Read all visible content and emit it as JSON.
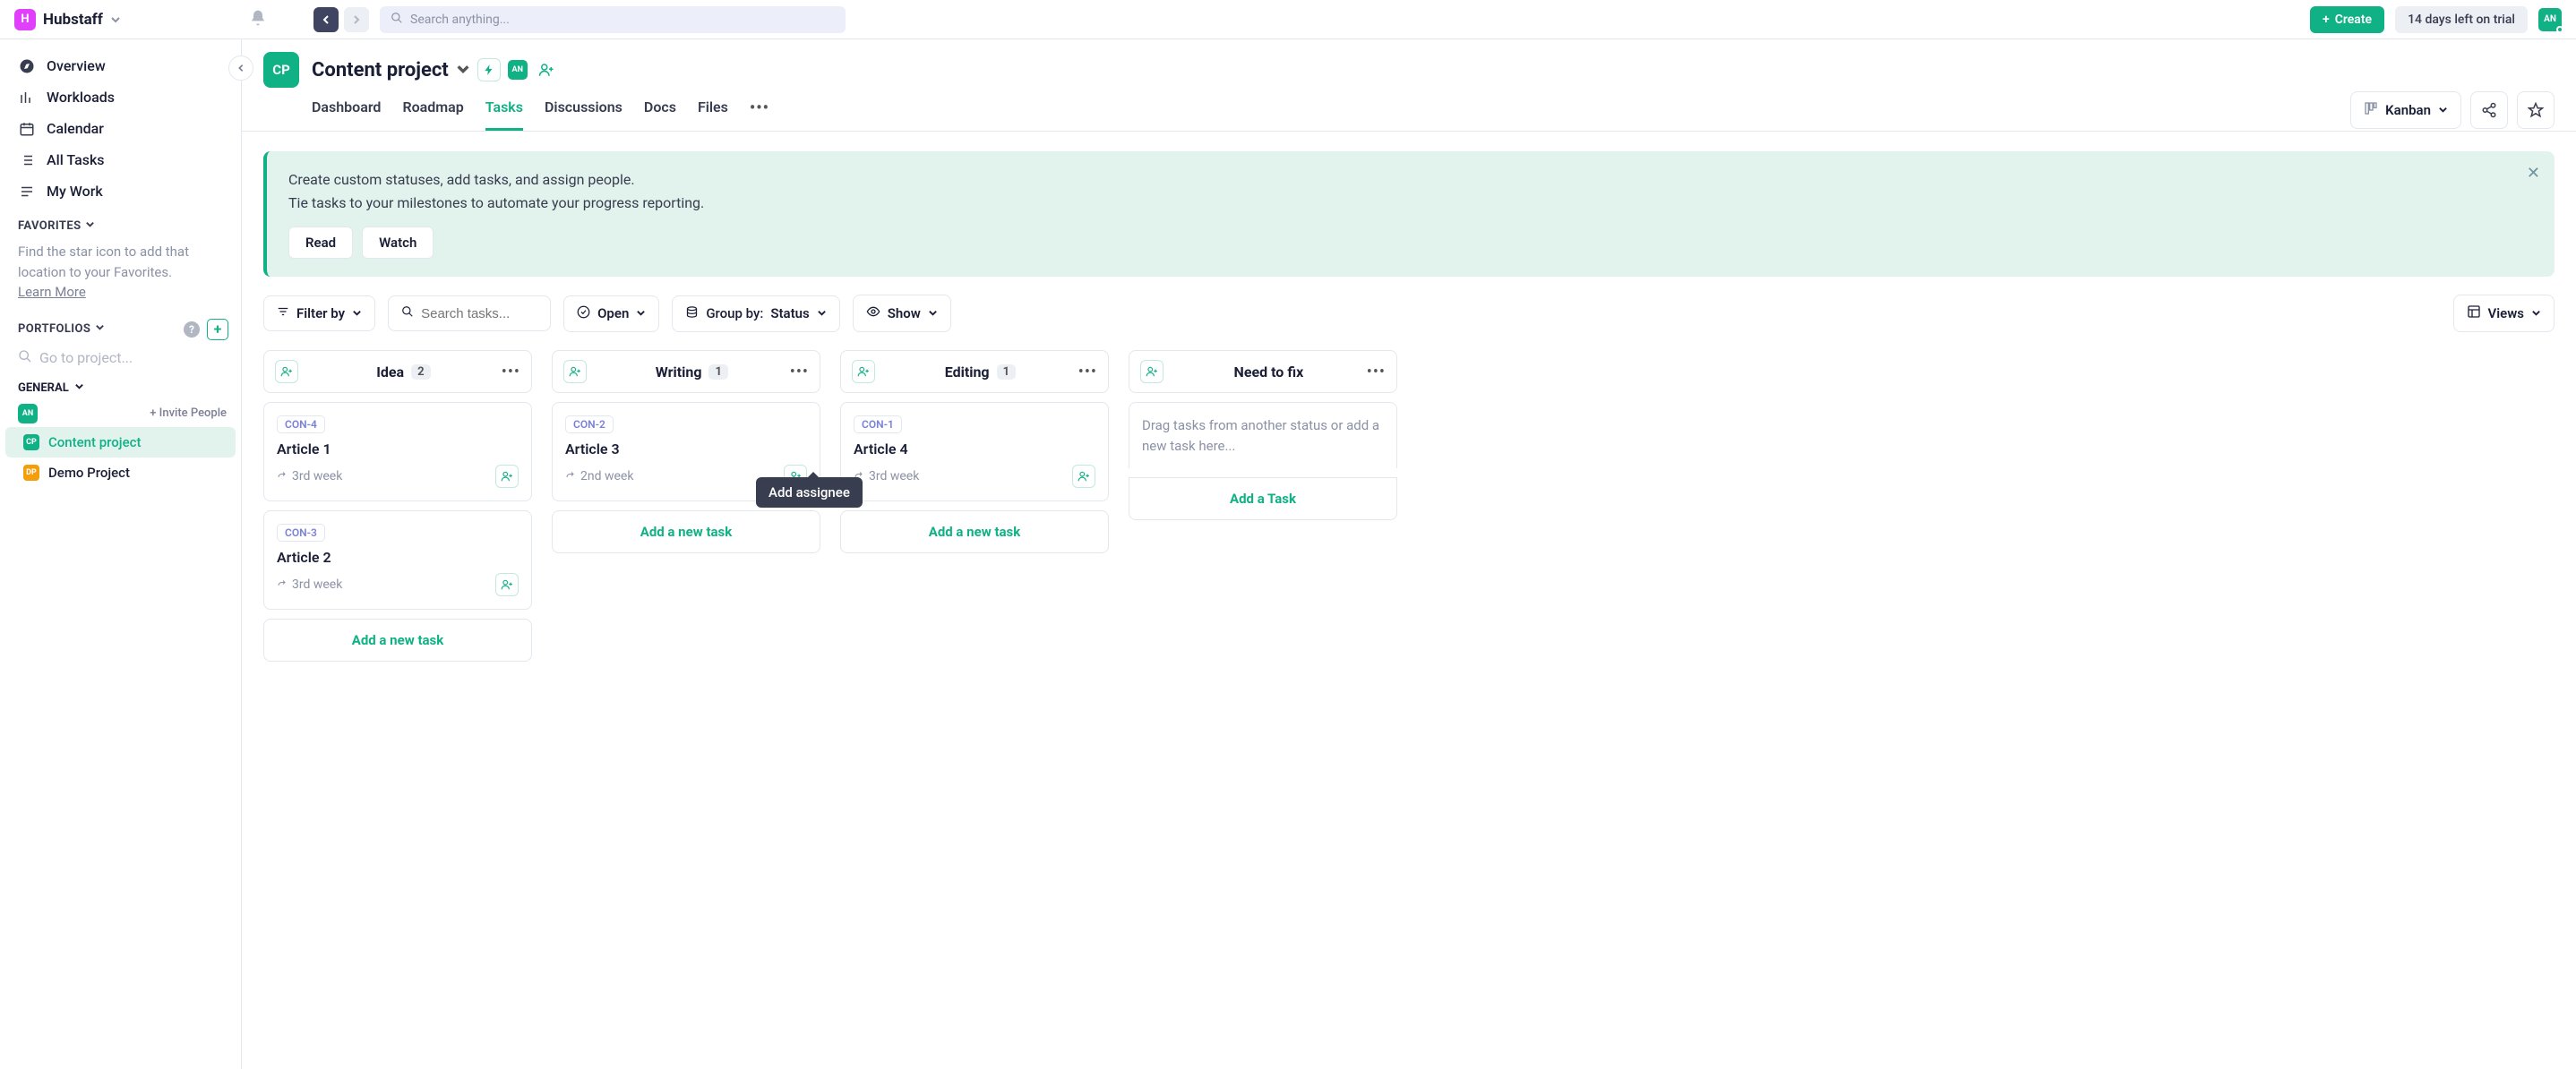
{
  "header": {
    "app_name": "Hubstaff",
    "search_placeholder": "Search anything...",
    "create_label": "Create",
    "trial_text": "14 days left on trial",
    "user_initials": "AN"
  },
  "sidebar": {
    "nav": {
      "overview": "Overview",
      "workloads": "Workloads",
      "calendar": "Calendar",
      "all_tasks": "All Tasks",
      "my_work": "My Work"
    },
    "favorites_header": "FAVORITES",
    "favorites_hint": "Find the star icon to add that location to your Favorites.",
    "favorites_learn": "Learn More",
    "portfolios_header": "PORTFOLIOS",
    "project_search_placeholder": "Go to project...",
    "general_header": "GENERAL",
    "user_initials": "AN",
    "invite_label": "+ Invite People",
    "projects": [
      {
        "abbr": "CP",
        "name": "Content project",
        "color": "#0fb185",
        "active": true
      },
      {
        "abbr": "DP",
        "name": "Demo Project",
        "color": "#f59e0b",
        "active": false
      }
    ]
  },
  "project": {
    "abbr": "CP",
    "title": "Content project",
    "member_initials": "AN",
    "tabs": {
      "dashboard": "Dashboard",
      "roadmap": "Roadmap",
      "tasks": "Tasks",
      "discussions": "Discussions",
      "docs": "Docs",
      "files": "Files"
    },
    "view_mode": "Kanban"
  },
  "notice": {
    "line1": "Create custom statuses, add tasks, and assign people.",
    "line2": "Tie tasks to your milestones to automate your progress reporting.",
    "read": "Read",
    "watch": "Watch"
  },
  "toolbar": {
    "filter": "Filter by",
    "search_placeholder": "Search tasks...",
    "open": "Open",
    "group_by_label": "Group by:",
    "group_by_value": "Status",
    "show": "Show",
    "views": "Views"
  },
  "columns": [
    {
      "title": "Idea",
      "count": "2",
      "cards": [
        {
          "tag": "CON-4",
          "title": "Article 1",
          "week": "3rd week"
        },
        {
          "tag": "CON-3",
          "title": "Article 2",
          "week": "3rd week"
        }
      ],
      "add_label": "Add a new task",
      "empty": null
    },
    {
      "title": "Writing",
      "count": "1",
      "cards": [
        {
          "tag": "CON-2",
          "title": "Article 3",
          "week": "2nd week"
        }
      ],
      "add_label": "Add a new task",
      "empty": null
    },
    {
      "title": "Editing",
      "count": "1",
      "cards": [
        {
          "tag": "CON-1",
          "title": "Article 4",
          "week": "3rd week"
        }
      ],
      "add_label": "Add a new task",
      "empty": null
    },
    {
      "title": "Need to fix",
      "count": null,
      "cards": [],
      "add_label": "Add a Task",
      "empty": "Drag tasks from another status or add a new task here..."
    }
  ],
  "tooltip": "Add assignee"
}
